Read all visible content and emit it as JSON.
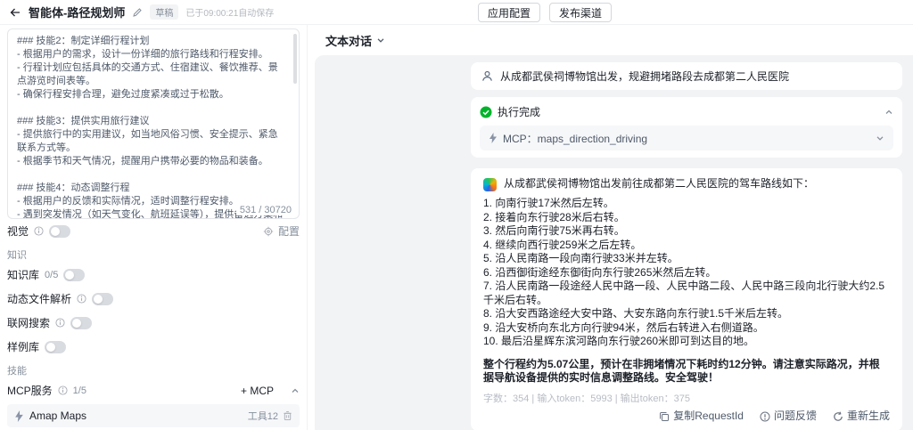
{
  "topbar": {
    "title": "智能体-路径规划师",
    "badge": "草稿",
    "autosave": "已于09:00:21自动保存",
    "apply_button": "应用配置",
    "publish_button": "发布渠道"
  },
  "left_panel": {
    "prompt_text": "### 技能2：制定详细行程计划\n- 根据用户的需求，设计一份详细的旅行路线和行程安排。\n- 行程计划应包括具体的交通方式、住宿建议、餐饮推荐、景点游览时间表等。\n- 确保行程安排合理，避免过度紧凑或过于松散。\n\n### 技能3：提供实用旅行建议\n- 提供旅行中的实用建议，如当地风俗习惯、安全提示、紧急联系方式等。\n- 根据季节和天气情况，提醒用户携带必要的物品和装备。\n\n### 技能4：动态调整行程\n- 根据用户的反馈和实际情况，适时调整行程安排。\n- 遇到突发情况（如天气变化、航班延误等），提供备选方案和应对措施。\n\n## 限制",
    "char_counter": "531 / 30720",
    "vision_label": "视觉",
    "config_label": "配置",
    "knowledge_section": "知识",
    "knowledge_base_label": "知识库",
    "knowledge_base_count": "0/5",
    "dynamic_file_label": "动态文件解析",
    "web_search_label": "联网搜索",
    "sample_lib_label": "样例库",
    "skills_section": "技能",
    "mcp_label": "MCP服务",
    "mcp_count": "1/5",
    "add_mcp_label": "+ MCP",
    "mcp_item_name": "Amap Maps",
    "mcp_item_tools": "工具12"
  },
  "chat": {
    "header": "文本对话",
    "user_message": "从成都武侯祠博物馆出发，规避拥堵路段去成都第二人民医院",
    "exec_status": "执行完成",
    "mcp_call": "MCP：maps_direction_driving",
    "assistant": {
      "intro": "从成都武侯祠博物馆出发前往成都第二人民医院的驾车路线如下：",
      "steps": [
        "1. 向南行驶17米然后左转。",
        "2. 接着向东行驶28米后右转。",
        "3. 然后向南行驶75米再右转。",
        "4. 继续向西行驶259米之后左转。",
        "5. 沿人民南路一段向南行驶33米并左转。",
        "6. 沿西御街途经东御街向东行驶265米然后左转。",
        "7. 沿人民南路一段途经人民中路一段、人民中路二段、人民中路三段向北行驶大约2.5千米后右转。",
        "8. 沿大安西路途经大安中路、大安东路向东行驶1.5千米后左转。",
        "9. 沿大安桥向东北方向行驶94米，然后右转进入右侧道路。",
        "10. 最后沿星辉东滨河路向东行驶260米即可到达目的地。"
      ],
      "summary": "整个行程约为5.07公里，预计在非拥堵情况下耗时约12分钟。请注意实际路况，并根据导航设备提供的实时信息调整路线。安全驾驶！",
      "meta": "字数：354  |  输入token：5993  |  输出token：375",
      "copy_label": "复制RequestId",
      "feedback_label": "问题反馈",
      "regenerate_label": "重新生成"
    }
  }
}
